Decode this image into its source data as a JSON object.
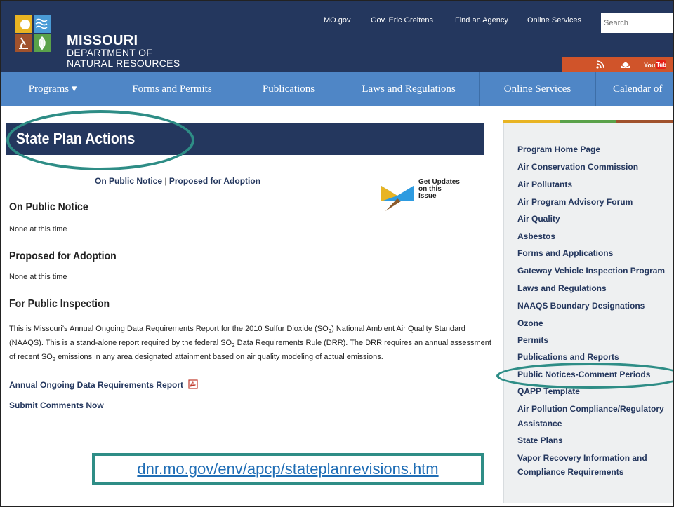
{
  "header": {
    "org_name_line1": "MISSOURI",
    "org_name_line2": "DEPARTMENT OF",
    "org_name_line3": "NATURAL RESOURCES",
    "top_links": [
      "MO.gov",
      "Gov. Eric Greitens",
      "Find an Agency",
      "Online Services"
    ],
    "search_placeholder": "Search",
    "social": [
      "rss-icon",
      "email-icon",
      "youtube-icon"
    ],
    "youtube_label": "You Tube"
  },
  "nav": {
    "items": [
      "Programs ▾",
      "Forms and Permits",
      "Publications",
      "Laws and Regulations",
      "Online Services",
      "Calendar of"
    ]
  },
  "main": {
    "title": "State Plan Actions",
    "quick_link_1": "On Public Notice",
    "separator": "|",
    "quick_link_2": "Proposed for Adoption",
    "updates_label": "Get Updates on this Issue",
    "sections": [
      {
        "heading": "On Public Notice",
        "text": "None at this time"
      },
      {
        "heading": "Proposed for Adoption",
        "text": "None at this time"
      },
      {
        "heading": "For Public Inspection",
        "text": ""
      }
    ],
    "paragraph_a": "This is Missouri’s Annual Ongoing Data Requirements Report for the 2010 Sulfur Dioxide (SO",
    "paragraph_b": ") National Ambient Air Quality Standard (NAAQS). This is a stand-alone report required by the federal SO",
    "paragraph_c": " Data Requirements Rule (DRR). The DRR requires an annual assessment of recent SO",
    "paragraph_d": " emissions in any area designated attainment based on air quality modeling of actual emissions.",
    "subscript": "2",
    "report_link": "Annual Ongoing Data Requirements Report",
    "comment_link": "Submit Comments Now",
    "url_overlay": "dnr.mo.gov/env/apcp/stateplanrevisions.htm"
  },
  "sidebar": {
    "items": [
      "Program Home Page",
      "Air Conservation Commission",
      "Air Pollutants",
      "Air Program Advisory Forum",
      "Air Quality",
      "Asbestos",
      "Forms and Applications",
      "Gateway Vehicle Inspection Program",
      "Laws and Regulations",
      "NAAQS Boundary Designations",
      "Ozone",
      "Permits",
      "Publications and Reports",
      "Public Notices-Comment Periods",
      "QAPP Template",
      "Air Pollution Compliance/Regulatory",
      "Assistance",
      "State Plans",
      "Vapor Recovery Information and",
      "Compliance Requirements"
    ]
  },
  "colors": {
    "header_bg": "#24375e",
    "nav_bg": "#4f86c6",
    "accent_teal": "#2e8d86",
    "link_blue": "#1f6db5",
    "social_orange": "#d0542a"
  }
}
